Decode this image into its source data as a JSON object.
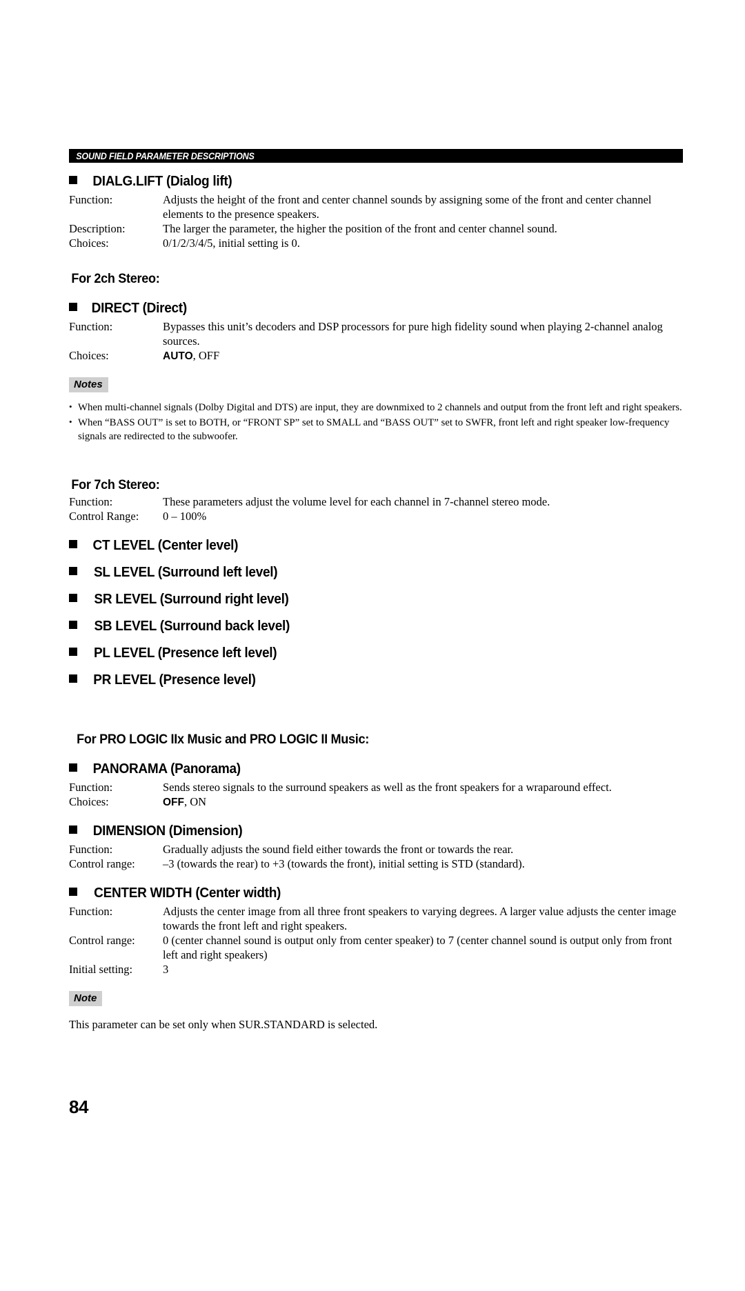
{
  "header": {
    "running_title": "SOUND FIELD PARAMETER DESCRIPTIONS"
  },
  "sections": {
    "dialg_lift": {
      "heading": "DIALG.LIFT (Dialog lift)",
      "rows": [
        {
          "label": "Function:",
          "value": "Adjusts the height of the front and center channel sounds by assigning some of the front and center channel elements to the presence speakers."
        },
        {
          "label": "Description:",
          "value": "The larger the parameter, the higher the position of the front and center channel sound."
        },
        {
          "label": "Choices:",
          "value": "0/1/2/3/4/5, initial setting is 0."
        }
      ]
    },
    "for_2ch_stereo": {
      "heading": "For 2ch Stereo:"
    },
    "direct": {
      "heading": "DIRECT (Direct)",
      "rows": [
        {
          "label": "Function:",
          "value": "Bypasses this unit’s decoders and DSP processors for pure high fidelity sound when playing 2-channel analog sources."
        }
      ],
      "choices_label": "Choices:",
      "choices_bold": "AUTO",
      "choices_rest": ", OFF",
      "notes_badge": "Notes",
      "notes": [
        "When multi-channel signals (Dolby Digital and DTS) are input, they are downmixed to 2 channels and output from the front left and right speakers.",
        "When “BASS OUT” is set to BOTH, or “FRONT SP” set to SMALL and “BASS OUT” set to SWFR, front left and right speaker low-frequency signals are redirected to the subwoofer."
      ]
    },
    "for_7ch_stereo": {
      "heading": "For 7ch Stereo:",
      "rows": [
        {
          "label": "Function:",
          "value": "These parameters adjust the volume level for each channel in 7-channel stereo mode."
        },
        {
          "label": "Control Range:",
          "value": "0 – 100%"
        }
      ],
      "levels": [
        "CT LEVEL (Center level)",
        "SL LEVEL (Surround left level)",
        "SR LEVEL (Surround right level)",
        "SB LEVEL (Surround back level)",
        "PL LEVEL (Presence left level)",
        "PR LEVEL (Presence level)"
      ]
    },
    "for_pro_logic": {
      "heading": "For PRO LOGIC IIx Music and PRO LOGIC II Music:"
    },
    "panorama": {
      "heading": "PANORAMA (Panorama)",
      "rows": [
        {
          "label": "Function:",
          "value": "Sends stereo signals to the surround speakers as well as the front speakers for a wraparound effect."
        }
      ],
      "choices_label": "Choices:",
      "choices_bold": "OFF",
      "choices_rest": ", ON"
    },
    "dimension": {
      "heading": "DIMENSION (Dimension)",
      "rows": [
        {
          "label": "Function:",
          "value": "Gradually adjusts the sound field either towards the front or towards the rear."
        },
        {
          "label": "Control range:",
          "value": "–3 (towards the rear) to +3 (towards the front), initial setting is STD (standard)."
        }
      ]
    },
    "center_width": {
      "heading": "CENTER WIDTH (Center width)",
      "rows": [
        {
          "label": "Function:",
          "value": "Adjusts the center image from all three front speakers to varying degrees. A larger value adjusts the center image towards the front left and right speakers."
        },
        {
          "label": "Control range:",
          "value": "0 (center channel sound is output only from center speaker) to 7 (center channel sound is output only from front left and right speakers)"
        },
        {
          "label": "Initial setting:",
          "value": "3"
        }
      ],
      "note_badge": "Note",
      "note_text": "This parameter can be set only when SUR.STANDARD is selected."
    }
  },
  "footer": {
    "page_number": "84"
  }
}
